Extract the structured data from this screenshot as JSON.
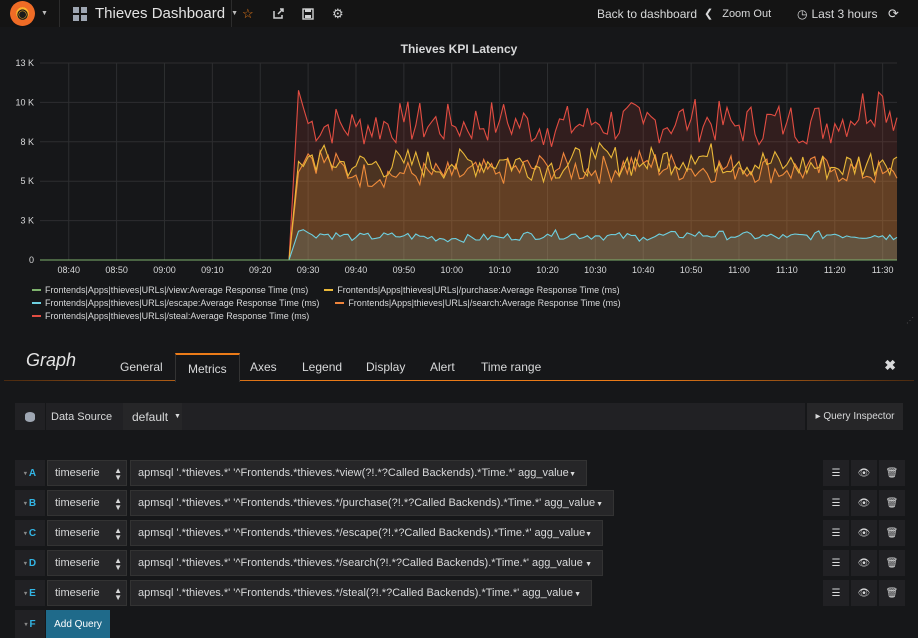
{
  "navbar": {
    "logo_glyph": "◉",
    "dashboard_title": "Thieves Dashboard",
    "back_to_dashboard": "Back to dashboard",
    "zoom_out": "Zoom Out",
    "time_range": "Last 3 hours",
    "icons": [
      "grafana-logo-icon",
      "dashboard-grid-icon",
      "star-icon",
      "share-icon",
      "save-icon",
      "settings-gear-icon",
      "chevron-left-icon",
      "clock-icon",
      "refresh-icon"
    ]
  },
  "chart_data": {
    "type": "area",
    "title": "Thieves KPI Latency",
    "xlabel": "",
    "ylabel": "",
    "x_ticks": [
      "08:40",
      "08:50",
      "09:00",
      "09:10",
      "09:20",
      "09:30",
      "09:40",
      "09:50",
      "10:00",
      "10:10",
      "10:20",
      "10:30",
      "10:40",
      "10:50",
      "11:00",
      "11:10",
      "11:20",
      "11:30"
    ],
    "y_ticks": [
      "0",
      "3 K",
      "5 K",
      "8 K",
      "10 K",
      "13 K"
    ],
    "ylim": [
      0,
      13000
    ],
    "x_range": [
      "08:34",
      "11:33"
    ],
    "grid": true,
    "legend_placement": "bottom",
    "series": [
      {
        "name": "Frontends|Apps|thieves|URLs|/view:Average Response Time (ms)",
        "color": "#7eb26d",
        "points": [
          [
            "08:34",
            0
          ],
          [
            "09:26",
            0
          ],
          [
            "09:27",
            0
          ],
          [
            "11:33",
            0
          ]
        ]
      },
      {
        "name": "Frontends|Apps|thieves|URLs|/purchase:Average Response Time (ms)",
        "color": "#eab839",
        "points": [
          [
            "08:34",
            0
          ],
          [
            "09:26",
            0
          ],
          [
            "09:28",
            6500
          ],
          [
            "09:30",
            6800
          ],
          [
            "09:40",
            6200
          ],
          [
            "09:50",
            6400
          ],
          [
            "10:00",
            6300
          ],
          [
            "10:10",
            6600
          ],
          [
            "10:20",
            6100
          ],
          [
            "10:30",
            6700
          ],
          [
            "10:40",
            6400
          ],
          [
            "10:50",
            6900
          ],
          [
            "11:00",
            6500
          ],
          [
            "11:10",
            6300
          ],
          [
            "11:20",
            6100
          ],
          [
            "11:30",
            6600
          ],
          [
            "11:33",
            6800
          ]
        ]
      },
      {
        "name": "Frontends|Apps|thieves|URLs|/escape:Average Response Time (ms)",
        "color": "#6ed0e0",
        "points": [
          [
            "08:34",
            0
          ],
          [
            "09:26",
            0
          ],
          [
            "09:28",
            1900
          ],
          [
            "09:30",
            1800
          ],
          [
            "09:40",
            1500
          ],
          [
            "09:50",
            1600
          ],
          [
            "10:00",
            1400
          ],
          [
            "10:10",
            1500
          ],
          [
            "10:20",
            1700
          ],
          [
            "10:30",
            1600
          ],
          [
            "10:40",
            1500
          ],
          [
            "10:50",
            1700
          ],
          [
            "11:00",
            1600
          ],
          [
            "11:10",
            1500
          ],
          [
            "11:20",
            1700
          ],
          [
            "11:30",
            1600
          ],
          [
            "11:33",
            1500
          ]
        ]
      },
      {
        "name": "Frontends|Apps|thieves|URLs|/search:Average Response Time (ms)",
        "color": "#ef843c",
        "points": [
          [
            "08:34",
            0
          ],
          [
            "09:26",
            0
          ],
          [
            "09:28",
            5800
          ],
          [
            "09:30",
            7000
          ],
          [
            "09:40",
            5600
          ],
          [
            "09:50",
            5700
          ],
          [
            "10:00",
            5600
          ],
          [
            "10:10",
            5800
          ],
          [
            "10:20",
            6200
          ],
          [
            "10:30",
            5900
          ],
          [
            "10:40",
            6400
          ],
          [
            "10:50",
            6000
          ],
          [
            "11:00",
            6100
          ],
          [
            "11:10",
            5900
          ],
          [
            "11:20",
            6000
          ],
          [
            "11:30",
            5700
          ],
          [
            "11:33",
            5400
          ]
        ]
      },
      {
        "name": "Frontends|Apps|thieves|URLs|/steal:Average Response Time (ms)",
        "color": "#e24d42",
        "points": [
          [
            "08:34",
            0
          ],
          [
            "09:26",
            0
          ],
          [
            "09:28",
            11200
          ],
          [
            "09:30",
            9000
          ],
          [
            "09:40",
            8800
          ],
          [
            "09:50",
            9100
          ],
          [
            "10:00",
            8900
          ],
          [
            "10:10",
            9200
          ],
          [
            "10:20",
            8700
          ],
          [
            "10:30",
            9100
          ],
          [
            "10:40",
            9000
          ],
          [
            "10:50",
            9300
          ],
          [
            "11:00",
            8900
          ],
          [
            "11:10",
            9100
          ],
          [
            "11:20",
            9000
          ],
          [
            "11:30",
            10800
          ],
          [
            "11:33",
            9400
          ]
        ]
      }
    ]
  },
  "editor": {
    "title": "Graph",
    "tabs": [
      "General",
      "Metrics",
      "Axes",
      "Legend",
      "Display",
      "Alert",
      "Time range"
    ],
    "active_tab": "Metrics",
    "close_glyph": "✖",
    "datasource_label": "Data Source",
    "datasource_value": "default",
    "query_inspector": "▸ Query Inspector",
    "queries": [
      {
        "ref": "A",
        "type": "timeserie",
        "text": "apmsql '.*thieves.*' '^Frontends.*thieves.*view(?!.*?Called Backends).*Time.*' agg_value"
      },
      {
        "ref": "B",
        "type": "timeserie",
        "text": "apmsql '.*thieves.*' '^Frontends.*thieves.*/purchase(?!.*?Called Backends).*Time.*' agg_value"
      },
      {
        "ref": "C",
        "type": "timeserie",
        "text": "apmsql '.*thieves.*' '^Frontends.*thieves.*/escape(?!.*?Called Backends).*Time.*' agg_value"
      },
      {
        "ref": "D",
        "type": "timeserie",
        "text": "apmsql '.*thieves.*' '^Frontends.*thieves.*/search(?!.*?Called Backends).*Time.*' agg_value"
      },
      {
        "ref": "E",
        "type": "timeserie",
        "text": "apmsql '.*thieves.*' '^Frontends.*thieves.*/steal(?!.*?Called Backends).*Time.*' agg_value"
      }
    ],
    "next_ref": "F",
    "add_query": "Add Query",
    "action_glyphs": {
      "menu": "☰",
      "toggle": "👁",
      "delete": "🗑"
    }
  }
}
